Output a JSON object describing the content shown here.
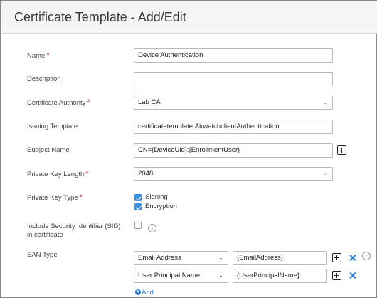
{
  "title": "Certificate Template - Add/Edit",
  "fields": {
    "name": {
      "label": "Name",
      "value": "Device Authentication"
    },
    "description": {
      "label": "Description",
      "value": ""
    },
    "certificate_authority": {
      "label": "Certificate Authority",
      "value": "Lab CA"
    },
    "issuing_template": {
      "label": "Issuing Template",
      "value": "certificatetemplate:AirwatchclientAuthentication"
    },
    "subject_name": {
      "label": "Subject Name",
      "value": "CN={DeviceUid}:{EnrollmentUser}"
    },
    "private_key_length": {
      "label": "Private Key Length",
      "value": "2048"
    },
    "private_key_type": {
      "label": "Private Key Type",
      "options": [
        {
          "label": "Signing",
          "checked": true
        },
        {
          "label": "Encryption",
          "checked": true
        }
      ]
    },
    "include_sid": {
      "label": "Include Security Identifier (SID) in certificate",
      "checked": false
    },
    "san_type": {
      "label": "SAN Type",
      "rows": [
        {
          "type": "Email Address",
          "value": "{EmailAddress}"
        },
        {
          "type": "User Principal Name",
          "value": "{UserPrincipalName}"
        }
      ],
      "add_label": "Add"
    }
  },
  "required_marker": "*",
  "icons": {
    "add": "plus-square-icon",
    "remove": "x-icon",
    "info": "info-icon",
    "dropdown": "chevron-down-icon"
  }
}
